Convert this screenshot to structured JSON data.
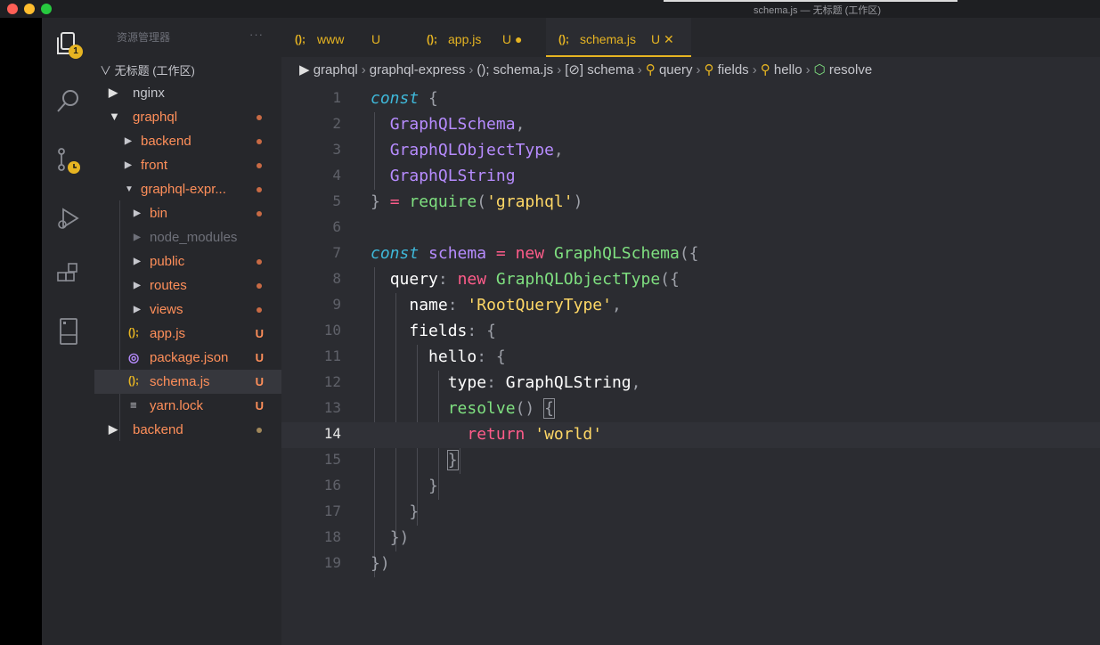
{
  "window": {
    "title": "schema.js — 无标题 (工作区)"
  },
  "activity_bar": {
    "icons": [
      "files-icon",
      "search-icon",
      "source-control-icon",
      "debug-icon",
      "extensions-icon",
      "remote-icon"
    ],
    "explorer_badge": "1"
  },
  "sidebar": {
    "header": "资源管理器",
    "more": "···",
    "workspace": "∨ 无标题 (工作区)",
    "tree": [
      {
        "name": "nginx",
        "color": "#c5c6cc",
        "status": ""
      },
      {
        "name": "graphql",
        "color": "#ff8f5a",
        "status": "dot"
      },
      {
        "name": "backend",
        "color": "#ff8f5a",
        "status": "dot"
      },
      {
        "name": "front",
        "color": "#ff8f5a",
        "status": "dot"
      },
      {
        "name": "graphql-expr...",
        "color": "#ff8f5a",
        "status": "dot"
      },
      {
        "name": "bin",
        "color": "#ff8f5a",
        "status": "dot"
      },
      {
        "name": "node_modules",
        "color": "#6e7079",
        "status": ""
      },
      {
        "name": "public",
        "color": "#ff8f5a",
        "status": "dot"
      },
      {
        "name": "routes",
        "color": "#ff8f5a",
        "status": "dot"
      },
      {
        "name": "views",
        "color": "#ff8f5a",
        "status": "dot"
      },
      {
        "name": "app.js",
        "color": "#ff8f5a",
        "status": "U"
      },
      {
        "name": "package.json",
        "color": "#ff8f5a",
        "status": "U"
      },
      {
        "name": "schema.js",
        "color": "#ff8f5a",
        "status": "U"
      },
      {
        "name": "yarn.lock",
        "color": "#ff8f5a",
        "status": "U"
      },
      {
        "name": "backend",
        "color": "#ff8f5a",
        "status": "dot"
      }
    ]
  },
  "tabs": [
    {
      "icon": "();",
      "label": "www",
      "status": "U"
    },
    {
      "icon": "();",
      "label": "app.js",
      "status": "U ●"
    },
    {
      "icon": "();",
      "label": "schema.js",
      "status": "U ✕"
    }
  ],
  "breadcrumb": {
    "items": [
      "graphql",
      "graphql-express",
      "(); schema.js",
      "[⊘] schema",
      "query",
      "fields",
      "hello",
      "resolve"
    ]
  },
  "editor": {
    "current_line": 14,
    "line_numbers": [
      "1",
      "2",
      "3",
      "4",
      "5",
      "6",
      "7",
      "8",
      "9",
      "10",
      "11",
      "12",
      "13",
      "14",
      "15",
      "16",
      "17",
      "18",
      "19"
    ]
  },
  "colors": {
    "accent": "#e6b422",
    "modified": "#ff8f5a",
    "keyword": "#ff5c8a",
    "string": "#ffd866",
    "class": "#7fe080"
  }
}
